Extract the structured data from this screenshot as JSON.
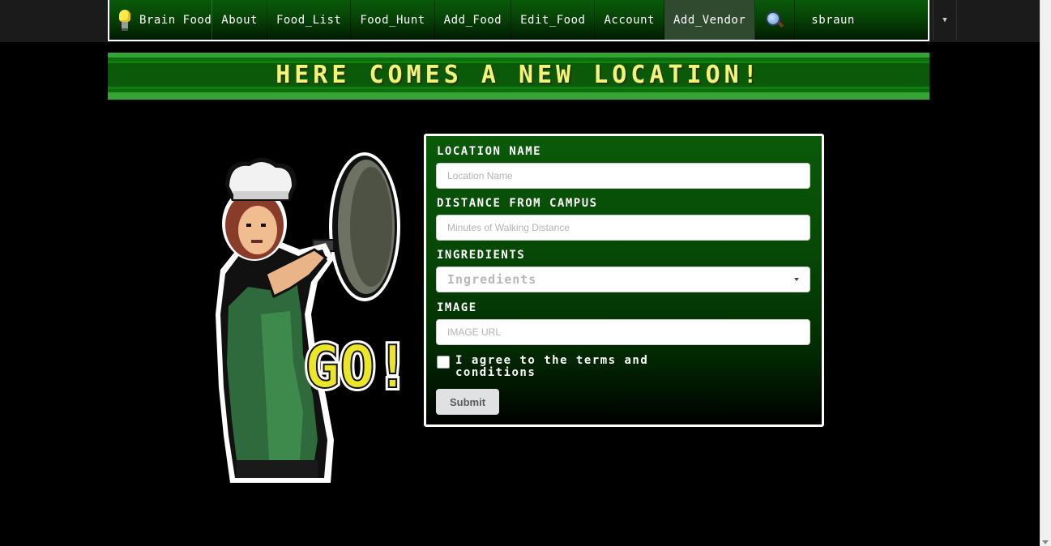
{
  "nav": {
    "brand": "Brain Food",
    "items": [
      {
        "label": "About"
      },
      {
        "label": "Food_List"
      },
      {
        "label": "Food_Hunt"
      },
      {
        "label": "Add_Food"
      },
      {
        "label": "Edit_Food"
      },
      {
        "label": "Account"
      },
      {
        "label": "Add_Vendor",
        "active": true
      }
    ],
    "user": "sbraun",
    "icons": {
      "brand": "lightbulb-icon",
      "search": "magnifier-icon",
      "dropdown": "caret-down-icon"
    }
  },
  "banner": {
    "title": "HERE COMES A NEW LOCATION!"
  },
  "art": {
    "text": "GO!"
  },
  "form": {
    "fields": [
      {
        "label": "LOCATION NAME",
        "placeholder": "Location Name"
      },
      {
        "label": "DISTANCE FROM CAMPUS",
        "placeholder": "Minutes of Walking Distance"
      },
      {
        "label": "INGREDIENTS",
        "placeholder": "Ingredients"
      },
      {
        "label": "IMAGE",
        "placeholder": "IMAGE URL"
      }
    ],
    "terms": "I agree to the terms and conditions",
    "submit": "Submit"
  },
  "colors": {
    "nav_green": "#0a5a0a",
    "banner_text": "#f3f37a",
    "background": "#000000"
  }
}
